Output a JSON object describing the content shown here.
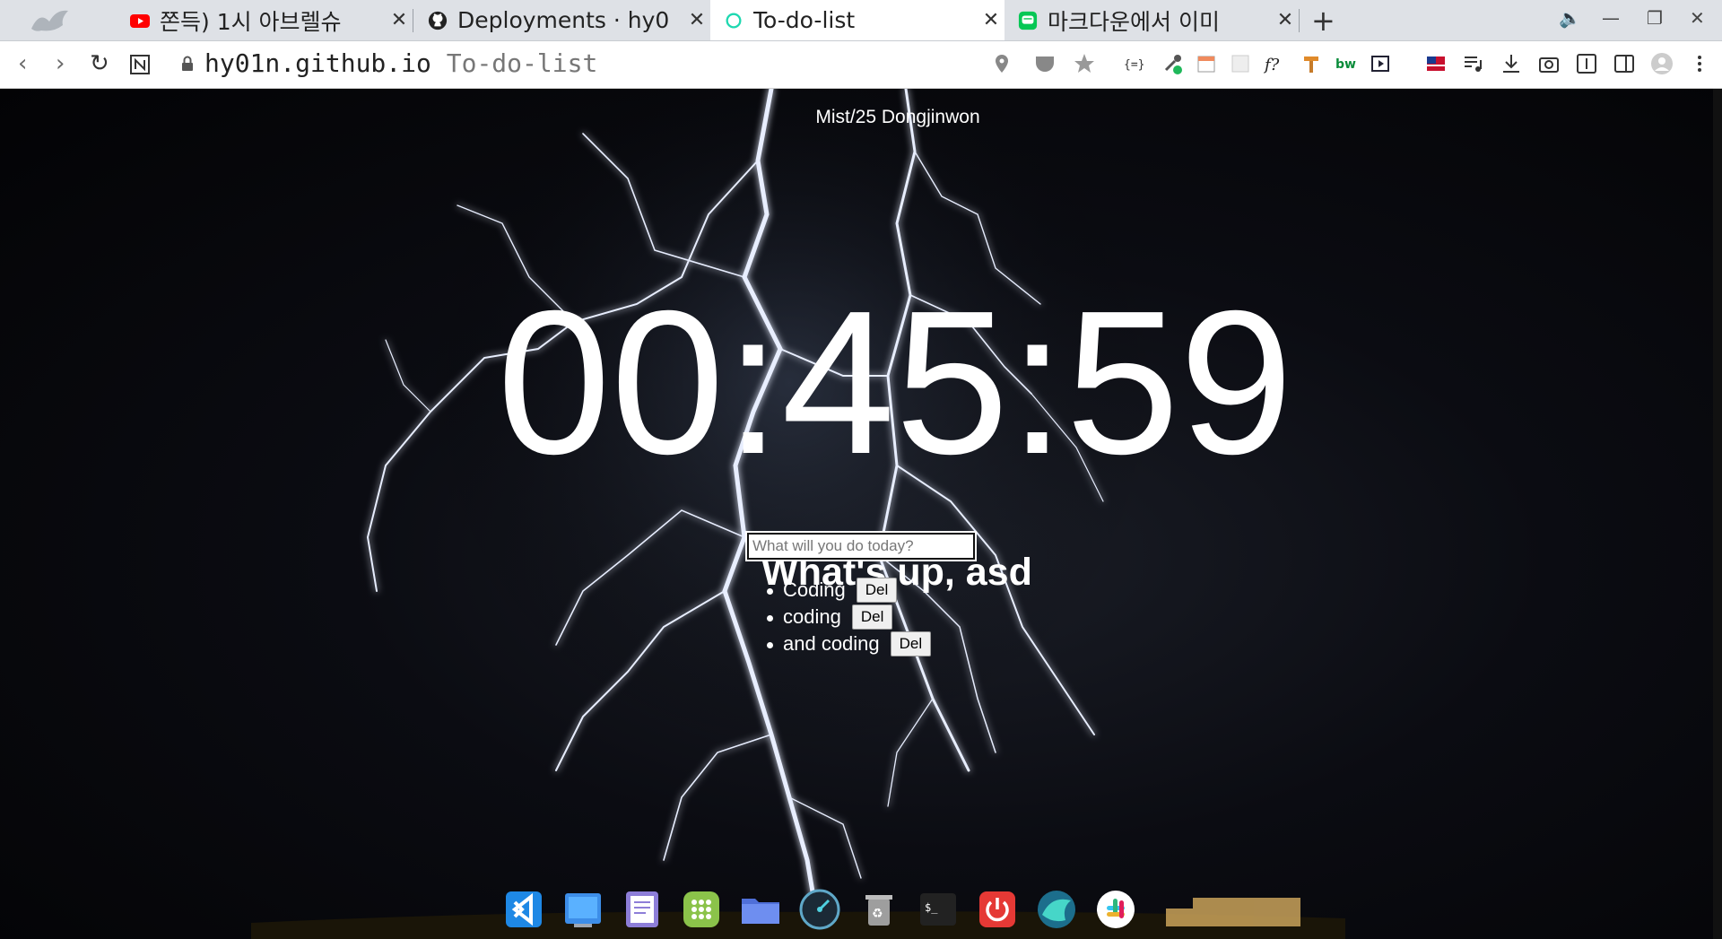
{
  "tabs": [
    {
      "title": "쫀득) 1시 아브렐슈",
      "icon": "youtube-icon",
      "active": false
    },
    {
      "title": "Deployments · hy0",
      "icon": "github-icon",
      "active": false
    },
    {
      "title": "To-do-list",
      "icon": "circle-icon",
      "active": true
    },
    {
      "title": "마크다운에서 이미",
      "icon": "chat-icon",
      "active": false
    }
  ],
  "new_tab_label": "+",
  "address_bar": {
    "domain": "hy01n.github.io",
    "path": "To-do-list"
  },
  "page": {
    "credit": "Mist/25 Dongjinwon",
    "clock": "00:45:59",
    "greeting": "What's up, asd",
    "input_placeholder": "What will you do today?",
    "todos": [
      {
        "text": "Coding",
        "button": "Del"
      },
      {
        "text": "coding",
        "button": "Del"
      },
      {
        "text": "and coding",
        "button": "Del"
      }
    ]
  },
  "dock_apps": [
    "vscode-icon",
    "desktop-icon",
    "notes-icon",
    "apps-grid-icon",
    "folder-icon",
    "stacer-icon",
    "trash-icon",
    "terminal-icon",
    "power-icon",
    "browser-icon",
    "slack-icon"
  ],
  "colors": {
    "tabbar": "#dee1e6",
    "page_bg": "#0b0c12",
    "text": "#ffffff",
    "youtube": "#ff0000",
    "line": "#06c755",
    "active_ring": "#1ed8b0"
  }
}
